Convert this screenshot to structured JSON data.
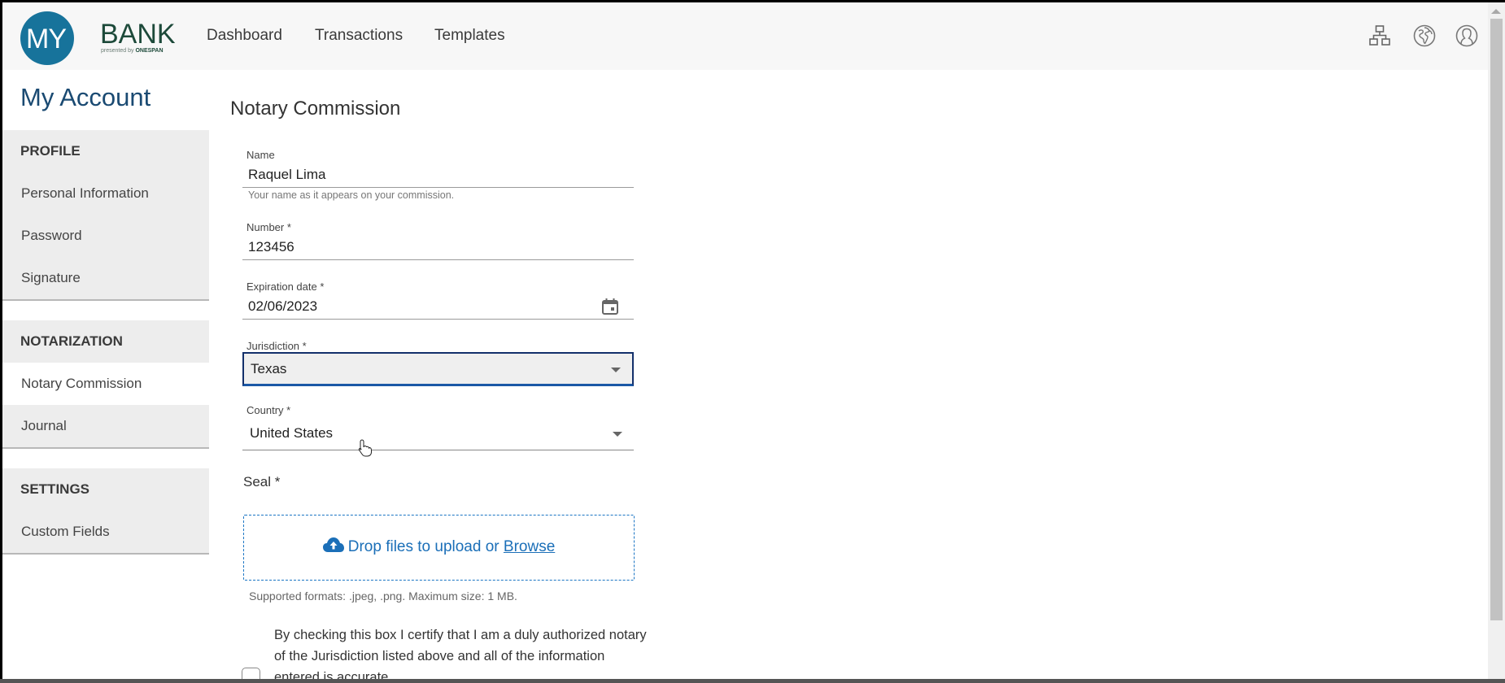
{
  "header": {
    "logo": {
      "circle_text": "MY",
      "brand_text": "BANK",
      "sub_text": "presented by",
      "sub_brand": "ONESPAN"
    },
    "nav": [
      {
        "label": "Dashboard"
      },
      {
        "label": "Transactions"
      },
      {
        "label": "Templates"
      }
    ],
    "icons": [
      "sitemap-icon",
      "globe-icon",
      "user-profile-icon"
    ]
  },
  "sidebar": {
    "title": "My Account",
    "groups": [
      {
        "heading": "PROFILE",
        "items": [
          {
            "label": "Personal Information"
          },
          {
            "label": "Password"
          },
          {
            "label": "Signature"
          }
        ]
      },
      {
        "heading": "NOTARIZATION",
        "items": [
          {
            "label": "Notary Commission",
            "active": true
          },
          {
            "label": "Journal"
          }
        ]
      },
      {
        "heading": "SETTINGS",
        "items": [
          {
            "label": "Custom Fields"
          }
        ]
      }
    ]
  },
  "main": {
    "title": "Notary Commission",
    "fields": {
      "name": {
        "label": "Name",
        "value": "Raquel Lima",
        "help": "Your name as it appears on your commission."
      },
      "number": {
        "label": "Number *",
        "value": "123456"
      },
      "expiration": {
        "label": "Expiration date *",
        "value": "02/06/2023"
      },
      "jurisdiction": {
        "label": "Jurisdiction *",
        "value": "Texas"
      },
      "country": {
        "label": "Country *",
        "value": "United States"
      }
    },
    "seal": {
      "label": "Seal *",
      "drop_text": "Drop files to upload or ",
      "browse_label": "Browse",
      "formats_text": "Supported formats: .jpeg, .png. Maximum size: 1 MB."
    },
    "certify": {
      "text": "By checking this box I certify that I am a duly authorized notary of the Jurisdiction listed above and all of the information entered is accurate.",
      "checked": false
    }
  },
  "colors": {
    "brand_blue": "#17739b",
    "title_blue": "#1a4a72",
    "link_blue": "#1b6fb8",
    "focus_border": "#13306b"
  }
}
